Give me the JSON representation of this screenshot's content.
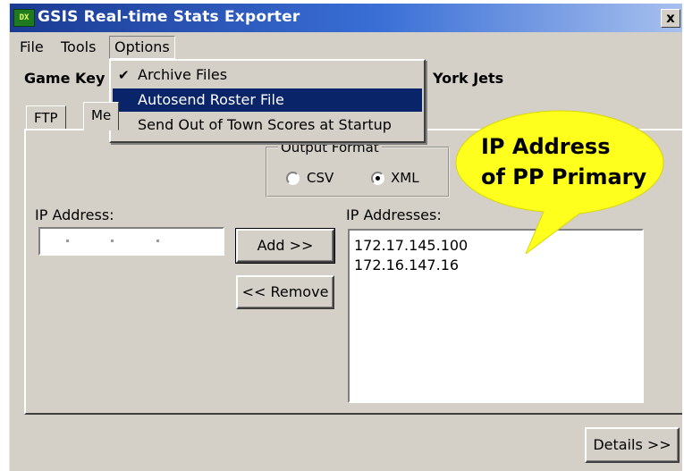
{
  "window": {
    "title": "GSIS Real-time Stats Exporter",
    "icon_text": "DX",
    "close_label": "x"
  },
  "menubar": {
    "items": [
      {
        "label": "File"
      },
      {
        "label": "Tools"
      },
      {
        "label": "Options"
      }
    ]
  },
  "options_menu": {
    "items": [
      {
        "label": "Archive Files",
        "checked": true,
        "highlighted": false
      },
      {
        "label": "Autosend Roster File",
        "checked": false,
        "highlighted": true
      },
      {
        "label": "Send Out of Town Scores at Startup",
        "checked": false,
        "highlighted": false
      }
    ],
    "check_glyph": "✔"
  },
  "game_key": {
    "label": "Game Key",
    "team_fragment": "York Jets"
  },
  "tabs": [
    {
      "label": "FTP",
      "active": false
    },
    {
      "label": "Me",
      "active": true
    }
  ],
  "output_format": {
    "legend": "Output Format",
    "options": [
      {
        "label": "CSV",
        "selected": false
      },
      {
        "label": "XML",
        "selected": true
      }
    ]
  },
  "ip_entry": {
    "label": "IP Address:",
    "value": ""
  },
  "buttons": {
    "add": "Add >>",
    "remove": "<< Remove",
    "details": "Details >>"
  },
  "ip_list": {
    "label": "IP Addresses:",
    "items": [
      "172.17.145.100",
      "172.16.147.16"
    ]
  },
  "annotation": {
    "line1": "IP Address",
    "line2": "of PP Primary",
    "color": "#ffff1e"
  }
}
